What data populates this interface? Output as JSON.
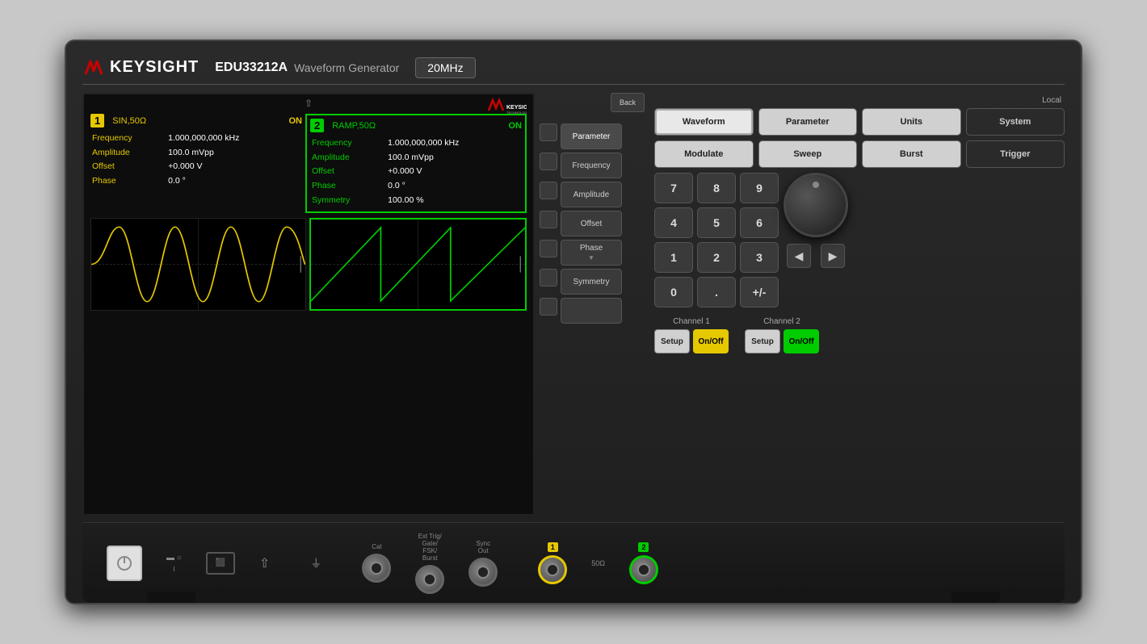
{
  "device": {
    "brand": "KEYSIGHT",
    "model": "EDU33212A",
    "type": "Waveform Generator",
    "frequency": "20MHz"
  },
  "display": {
    "usb_icon": "⇧",
    "channel1": {
      "number": "1",
      "type": "SIN,50Ω",
      "status": "ON",
      "params": {
        "frequency_label": "Frequency",
        "frequency_value": "1.000,000,000 kHz",
        "amplitude_label": "Amplitude",
        "amplitude_value": "100.0 mVpp",
        "offset_label": "Offset",
        "offset_value": "+0.000 V",
        "phase_label": "Phase",
        "phase_value": "0.0 °"
      }
    },
    "channel2": {
      "number": "2",
      "type": "RAMP,50Ω",
      "status": "ON",
      "params": {
        "frequency_label": "Frequency",
        "frequency_value": "1.000,000,000 kHz",
        "amplitude_label": "Amplitude",
        "amplitude_value": "100.0 mVpp",
        "offset_label": "Offset",
        "offset_value": "+0.000 V",
        "phase_label": "Phase",
        "phase_value": "0.0 °",
        "symmetry_label": "Symmetry",
        "symmetry_value": "100.00 %"
      }
    },
    "menu": {
      "items": [
        "Parameter",
        "Frequency",
        "Amplitude",
        "Offset",
        "Phase",
        "Symmetry"
      ]
    }
  },
  "controls": {
    "local_label": "Local",
    "back_label": "Back",
    "top_row": [
      "Waveform",
      "Parameter",
      "Units",
      "System"
    ],
    "second_row": [
      "Modulate",
      "Sweep",
      "Burst",
      "Trigger"
    ],
    "numpad": [
      "7",
      "8",
      "9",
      "4",
      "5",
      "6",
      "1",
      "2",
      "3",
      "0",
      ".",
      "+/-"
    ],
    "channel1": {
      "label": "Channel 1",
      "setup": "Setup",
      "onoff": "On/Off"
    },
    "channel2": {
      "label": "Channel 2",
      "setup": "Setup",
      "onoff": "On/Off"
    }
  },
  "bottom": {
    "cal_label": "Cal",
    "ext_trig_label": "Ext Trig/\nGate/\nFSK/\nBurst",
    "sync_out_label": "Sync\nOut",
    "ch1_label": "1",
    "ch2_label": "2",
    "fifty_ohm": "50Ω"
  }
}
